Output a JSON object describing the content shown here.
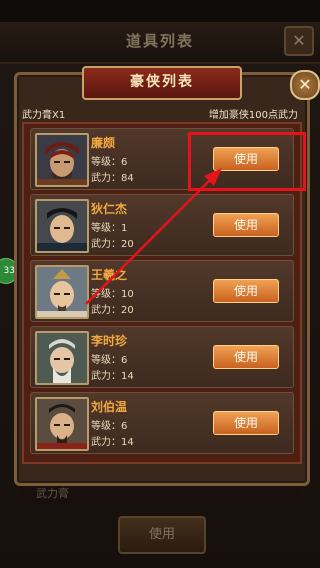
{
  "background": {
    "title": "道具列表",
    "close_icon": "close-icon",
    "item_label": "武力膏",
    "use_label": "使用",
    "badge": "33"
  },
  "modal": {
    "title": "豪侠列表",
    "close_icon": "close-icon",
    "item_info": "武力膏X1",
    "effect_info": "增加豪侠100点武力",
    "level_prefix": "等级：",
    "power_prefix": "武力："
  },
  "heroes": [
    {
      "name": "廉颇",
      "level": "6",
      "power": "84",
      "button": "使用"
    },
    {
      "name": "狄仁杰",
      "level": "1",
      "power": "20",
      "button": "使用"
    },
    {
      "name": "王羲之",
      "level": "10",
      "power": "20",
      "button": "使用"
    },
    {
      "name": "李时珍",
      "level": "6",
      "power": "14",
      "button": "使用"
    },
    {
      "name": "刘伯温",
      "level": "6",
      "power": "14",
      "button": "使用"
    }
  ],
  "annotation": {
    "highlight_color": "#e4141a",
    "arrow_color": "#e4141a"
  }
}
